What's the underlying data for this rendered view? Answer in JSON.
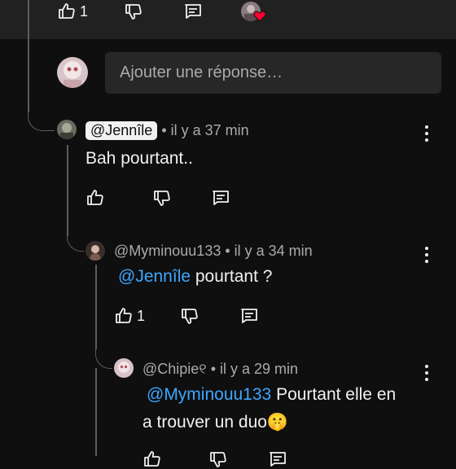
{
  "top_actions": {
    "like_count": "1"
  },
  "reply_input": {
    "placeholder": "Ajouter une réponse…"
  },
  "comments": [
    {
      "handle": "@Jennîle",
      "time": " • il y a 37 min",
      "body": "Bah pourtant.."
    },
    {
      "handle": "@Myminouu133",
      "time": " • il y a 34 min",
      "mention": "@Jennîle",
      "body": " pourtant ?",
      "like_count": "1"
    },
    {
      "handle": "@Chipie୧",
      "time": " • il y a 29 min",
      "mention": "@Myminouu133",
      "body_line1": " Pourtant elle en",
      "body_line2": "a trouver un duo🤫"
    }
  ],
  "icons": [
    "like-icon",
    "dislike-icon",
    "reply-icon",
    "heart-icon",
    "more-icon"
  ],
  "colors": {
    "background": "#0f0f0f",
    "mention": "#3ea6ff",
    "heart": "#ff0033",
    "secondary_text": "#aaaaaa"
  }
}
